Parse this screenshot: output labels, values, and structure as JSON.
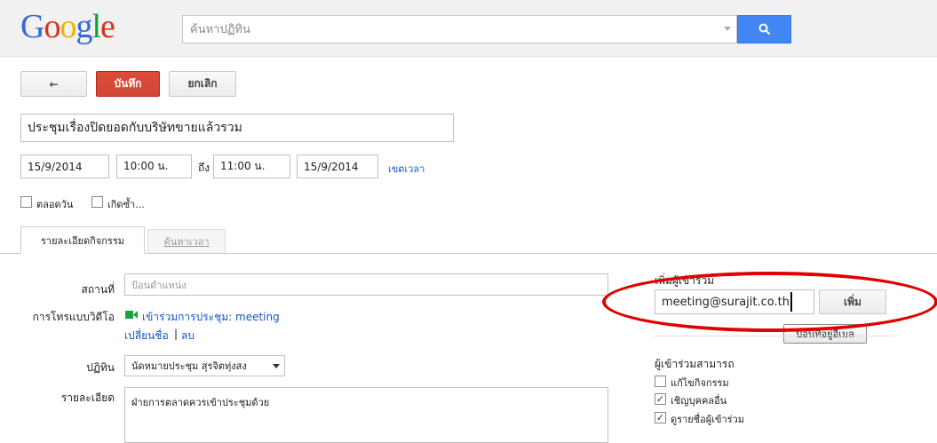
{
  "header": {
    "logo": {
      "G": "G",
      "o1": "o",
      "o2": "o",
      "g": "g",
      "l": "l",
      "e": "e"
    },
    "search_placeholder": "ค้นหาปฏิทิน"
  },
  "toolbar": {
    "back_label": "←",
    "save_label": "บันทึก",
    "cancel_label": "ยกเลิก"
  },
  "event": {
    "title": "ประชุมเรื่องปิดยอดกับบริษัทขายแล้วรวม",
    "start_date": "15/9/2014",
    "start_time": "10:00 น.",
    "to_label": "ถึง",
    "end_time": "11:00 น.",
    "end_date": "15/9/2014",
    "timezone_link": "เขตเวลา",
    "all_day_label": "ตลอดวัน",
    "repeat_label": "เกิดซ้ำ..."
  },
  "tabs": [
    {
      "label": "รายละเอียดกิจกรรม",
      "active": true
    },
    {
      "label": "ค้นหาเวลา",
      "active": false
    }
  ],
  "details": {
    "location_label": "สถานที่",
    "location_placeholder": "ป้อนตำแหน่ง",
    "video_label": "การโทรแบบวิดีโอ",
    "video_link": "เข้าร่วมการประชุม: meeting",
    "rename_link": "เปลี่ยนชื่อ",
    "separator": "|",
    "delete_link": "ลบ",
    "calendar_label": "ปฏิทิน",
    "calendar_value": "นัดหมายประชุม สุรจิตทุ่งสง",
    "description_label": "รายละเอียด",
    "description_value": "ฝ่ายการตลาดควรเข้าประชุมด้วย"
  },
  "guests": {
    "heading": "เพิ่มผู้เข้าร่วม",
    "input_value": "meeting@surajit.co.th",
    "add_button": "เพิ่ม",
    "tooltip": "ป้อนที่อยู่อีเมล",
    "can_label": "ผู้เข้าร่วมสามารถ",
    "permissions": [
      {
        "label": "แก้ไขกิจกรรม",
        "checked": false
      },
      {
        "label": "เชิญบุคคลอื่น",
        "checked": true
      },
      {
        "label": "ดูรายชื่อผู้เข้าร่วม",
        "checked": true
      }
    ]
  },
  "colors": {
    "accent_red": "#d14836",
    "link_blue": "#1155cc",
    "search_blue": "#4285f4",
    "annotation_red": "#e00000"
  }
}
